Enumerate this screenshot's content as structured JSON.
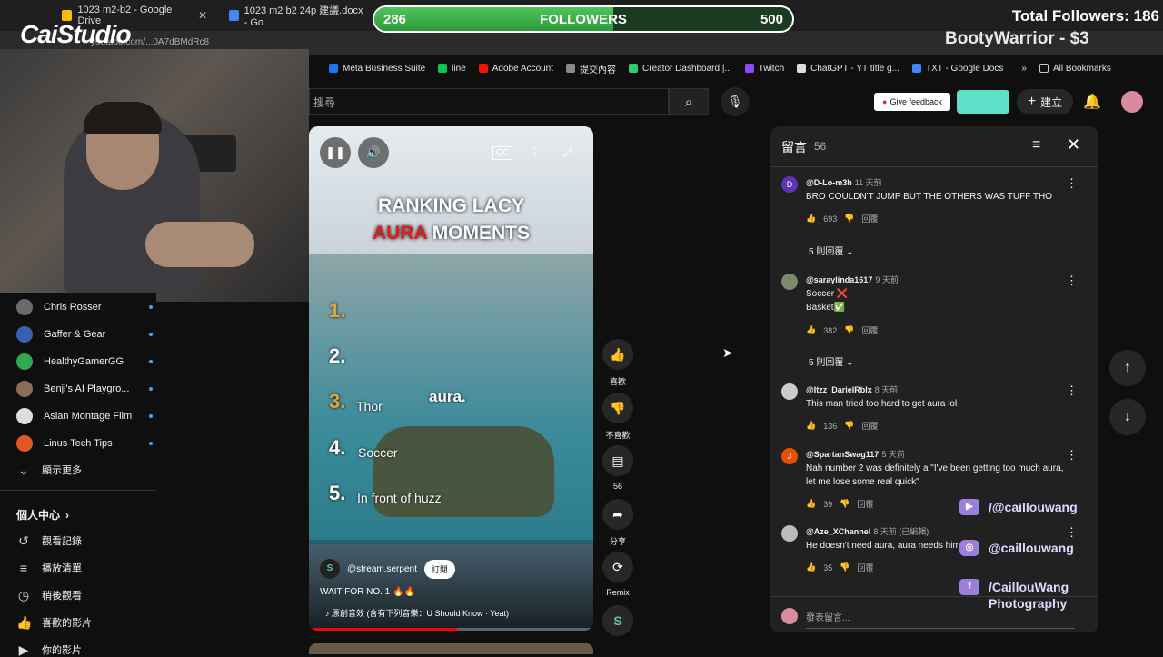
{
  "browser": {
    "tabs": [
      {
        "label": "1023 m2-b2 - Google Drive"
      },
      {
        "label": "1023 m2 b2 24p 建議.docx - Go"
      }
    ],
    "url": "youtube.com/...0A7dBMdRc8",
    "bookmarks": [
      {
        "label": "Meta Business Suite"
      },
      {
        "label": "line"
      },
      {
        "label": "Adobe Account"
      },
      {
        "label": "提交內容"
      },
      {
        "label": "Creator Dashboard |..."
      },
      {
        "label": "Twitch"
      },
      {
        "label": "ChatGPT - YT title g..."
      },
      {
        "label": "TXT - Google Docs"
      }
    ],
    "all_bookmarks": "All Bookmarks"
  },
  "overlay": {
    "logo": "CaiStudio",
    "followers_current": "286",
    "followers_label": "FOLLOWERS",
    "followers_goal": "500",
    "followers_progress": 0.572,
    "total_followers": "Total Followers: 186",
    "top_donor": "BootyWarrior - $3",
    "socials": [
      {
        "icon": "youtube-icon",
        "handle": "/@caillouwang"
      },
      {
        "icon": "instagram-icon",
        "handle": "@caillouwang"
      },
      {
        "icon": "facebook-icon",
        "handle": "/CaillouWang Photography"
      }
    ]
  },
  "sidebar": {
    "subscriptions": [
      {
        "name": "Chris Rosser",
        "color": "#6b6b6b"
      },
      {
        "name": "Gaffer & Gear",
        "color": "#3a5fb0"
      },
      {
        "name": "HealthyGamerGG",
        "color": "#2fa84f"
      },
      {
        "name": "Benji's AI Playgro...",
        "color": "#8a6d5a"
      },
      {
        "name": "Asian Montage Film",
        "color": "#dddddd"
      },
      {
        "name": "Linus Tech Tips",
        "color": "#e25822"
      }
    ],
    "show_more": "顯示更多",
    "you_section": "個人中心",
    "you_items": [
      {
        "label": "觀看記錄",
        "icon": "history-icon"
      },
      {
        "label": "播放清單",
        "icon": "playlist-icon"
      },
      {
        "label": "稍後觀看",
        "icon": "watch-later-icon"
      },
      {
        "label": "喜歡的影片",
        "icon": "like-icon"
      },
      {
        "label": "你的影片",
        "icon": "your-videos-icon"
      }
    ]
  },
  "header": {
    "search_placeholder": "搜尋",
    "feedback": "Give feedback",
    "create": "建立"
  },
  "video": {
    "title_line1": "RANKING LACY",
    "title_line2_accent": "AURA",
    "title_line2_rest": " MOMENTS",
    "ranks": [
      {
        "n": "1.",
        "label": ""
      },
      {
        "n": "2.",
        "label": ""
      },
      {
        "n": "3.",
        "label": "Thor"
      },
      {
        "n": "4.",
        "label": "Soccer"
      },
      {
        "n": "5.",
        "label": "In front of huzz"
      }
    ],
    "overlay_text": "aura.",
    "channel": "@stream.serpent",
    "subscribe": "訂閱",
    "caption": "WAIT FOR NO. 1 🔥🔥",
    "music": "♪ 原創音效 (含有下列音樂：U Should Know · Yeat)",
    "progress": 0.52
  },
  "actions": {
    "like": "喜歡",
    "dislike": "不喜歡",
    "comments": "56",
    "share": "分享",
    "remix": "Remix"
  },
  "comments": {
    "title": "留言",
    "count": "56",
    "input_placeholder": "發表留言...",
    "items": [
      {
        "author": "@D-Lo-m3h",
        "time": "11 天前",
        "text": "BRO COULDN'T JUMP BUT THE OTHERS WAS TUFF THO",
        "likes": "693",
        "reply": "回覆",
        "replies": "5 則回覆",
        "avatar": "D",
        "color": "#5e35b1"
      },
      {
        "author": "@saraylinda1617",
        "time": "9 天前",
        "text": "Soccer ❌\nBasket✅",
        "likes": "382",
        "reply": "回覆",
        "replies": "5 則回覆",
        "avatar": "",
        "color": "#7a8a6a"
      },
      {
        "author": "@Itzz_DarielRblx",
        "time": "8 天前",
        "text": "This man tried too hard to get aura lol",
        "likes": "136",
        "reply": "回覆",
        "replies": "",
        "avatar": "",
        "color": "#cccccc"
      },
      {
        "author": "@SpartanSwag117",
        "time": "5 天前",
        "text": "Nah number 2 was definitely a \"I've been getting too much aura, let me lose some real quick\"",
        "likes": "39",
        "reply": "回覆",
        "replies": "",
        "avatar": "J",
        "color": "#e65100"
      },
      {
        "author": "@Aze_XChannel",
        "time": "8 天前 (已編輯)",
        "text": "He doesn't need aura, aura needs him",
        "likes": "35",
        "reply": "回覆",
        "replies": "",
        "avatar": "",
        "color": "#bbbbbb"
      }
    ]
  }
}
